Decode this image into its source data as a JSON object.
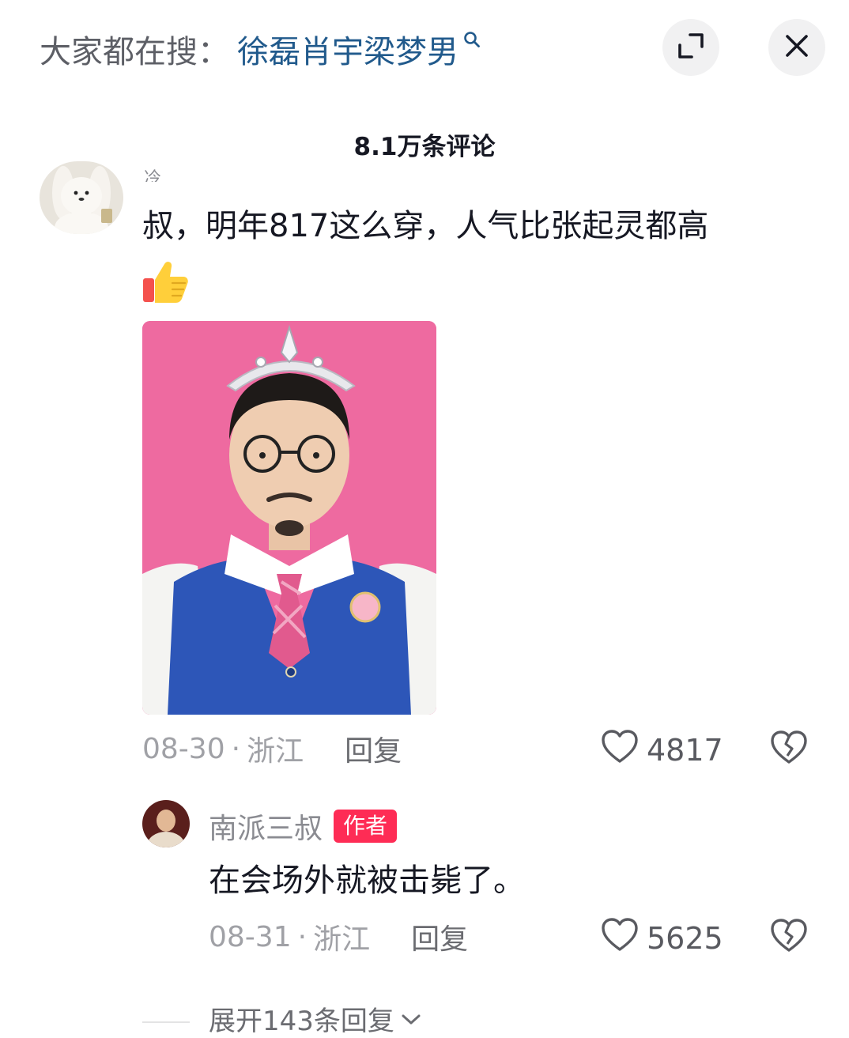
{
  "header": {
    "search_prefix": "大家都在搜：",
    "search_term": "徐磊肖宇梁梦男",
    "search_icon": "search-icon",
    "collapse_icon": "collapse-icon",
    "close_icon": "close-icon"
  },
  "comment_count": "8.1万条评论",
  "comments": [
    {
      "username_fragment": "冷",
      "text": "叔，明年817这么穿，人气比张起灵都高",
      "emoji": "thumbs-up-icon",
      "has_image": true,
      "image_description_icon": "photo",
      "date": "08-30",
      "location": "浙江",
      "separator": "·",
      "reply_label": "回复",
      "likes": "4817"
    }
  ],
  "reply": {
    "username": "南派三叔",
    "badge": "作者",
    "text": "在会场外就被击毙了。",
    "date": "08-31",
    "location": "浙江",
    "separator": "·",
    "reply_label": "回复",
    "likes": "5625"
  },
  "expand": {
    "label": "展开143条回复"
  },
  "colors": {
    "search_term": "#215a8c",
    "badge": "#fe2c55",
    "photo_background": "#ee6aa0"
  }
}
